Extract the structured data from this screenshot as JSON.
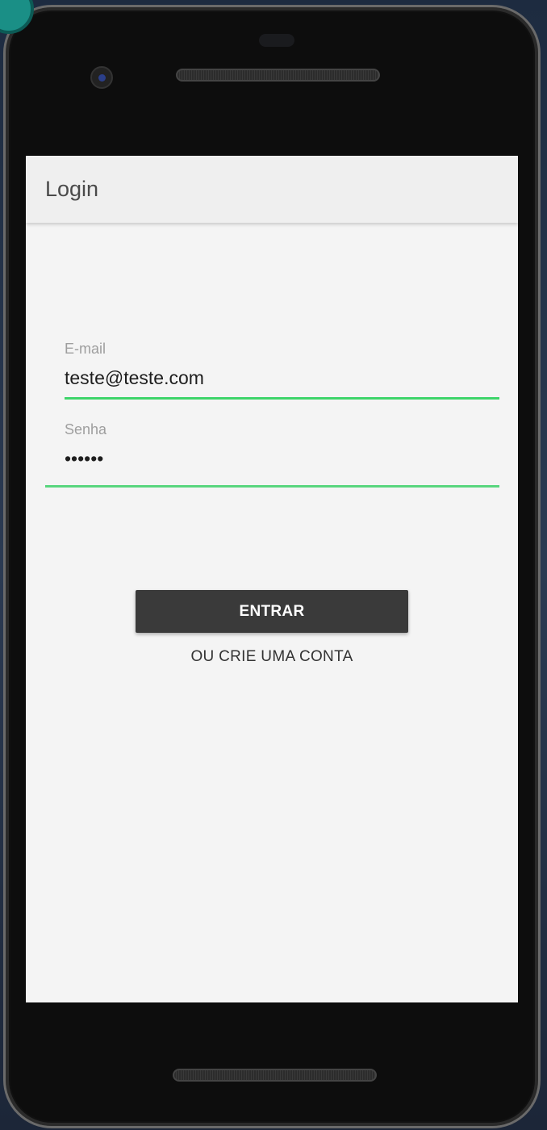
{
  "appbar": {
    "title": "Login"
  },
  "form": {
    "email": {
      "label": "E-mail",
      "value": "teste@teste.com"
    },
    "password": {
      "label": "Senha",
      "value": "••••••"
    }
  },
  "actions": {
    "submit_label": "ENTRAR",
    "create_account_label": "OU CRIE UMA CONTA"
  },
  "colors": {
    "accent": "#3ed56a",
    "button": "#3a3a3a"
  }
}
